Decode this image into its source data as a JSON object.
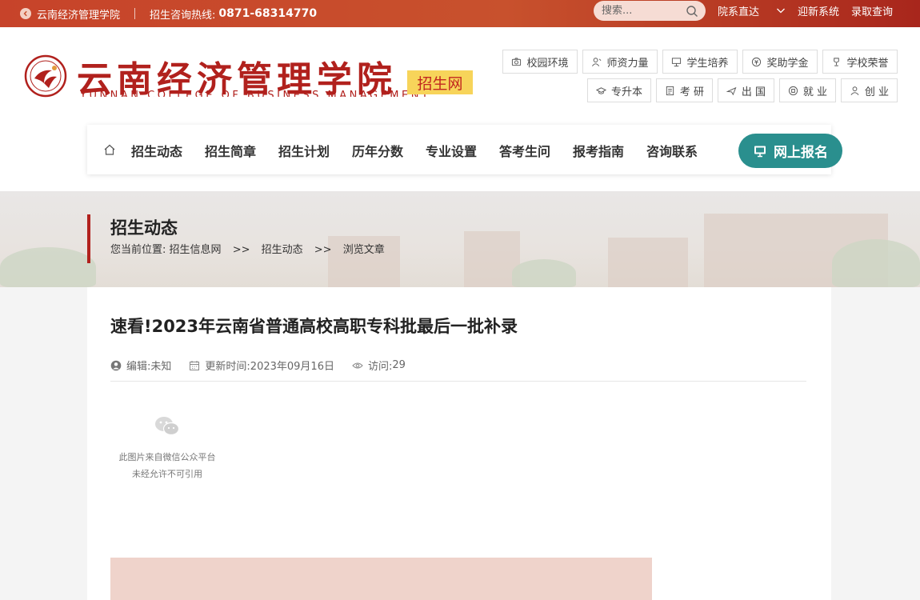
{
  "topbar": {
    "school_link": "云南经济管理学院",
    "hotline_label": "招生咨询热线:",
    "hotline_number": "0871-68314770",
    "search_placeholder": "搜索...",
    "links": [
      "院系直达",
      "迎新系统",
      "录取查询"
    ]
  },
  "header": {
    "logo_cn": "云南经济管理学院",
    "logo_en": "YUNNAN COLLEGE OF BUSINESS MANAGEMENT",
    "badge": "招生网",
    "quick_links_row1": [
      "校园环境",
      "师资力量",
      "学生培养",
      "奖助学金",
      "学校荣誉"
    ],
    "quick_links_row2": [
      "专升本",
      "考 研",
      "出 国",
      "就 业",
      "创 业"
    ]
  },
  "nav": {
    "items": [
      "招生动态",
      "招生简章",
      "招生计划",
      "历年分数",
      "专业设置",
      "答考生问",
      "报考指南",
      "咨询联系"
    ],
    "apply_button": "网上报名"
  },
  "banner": {
    "section_title": "招生动态",
    "breadcrumb_prefix": "您当前位置:",
    "breadcrumb": [
      "招生信息网",
      "招生动态",
      "浏览文章"
    ],
    "separator": ">>"
  },
  "article": {
    "title": "速看!2023年云南省普通高校高职专科批最后一批补录",
    "editor_label": "编辑:",
    "editor": "未知",
    "updated_label": "更新时间:",
    "updated": "2023年09月16日",
    "visits_label": "访问:",
    "visits": "29",
    "wechat_notice_line1": "此图片来自微信公众平台",
    "wechat_notice_line2": "未经允许不可引用"
  },
  "colors": {
    "brand_red": "#b1211d",
    "topbar_orange": "#c8512d",
    "teal_button": "#2a8f8e",
    "badge_yellow": "#f7d45a"
  }
}
